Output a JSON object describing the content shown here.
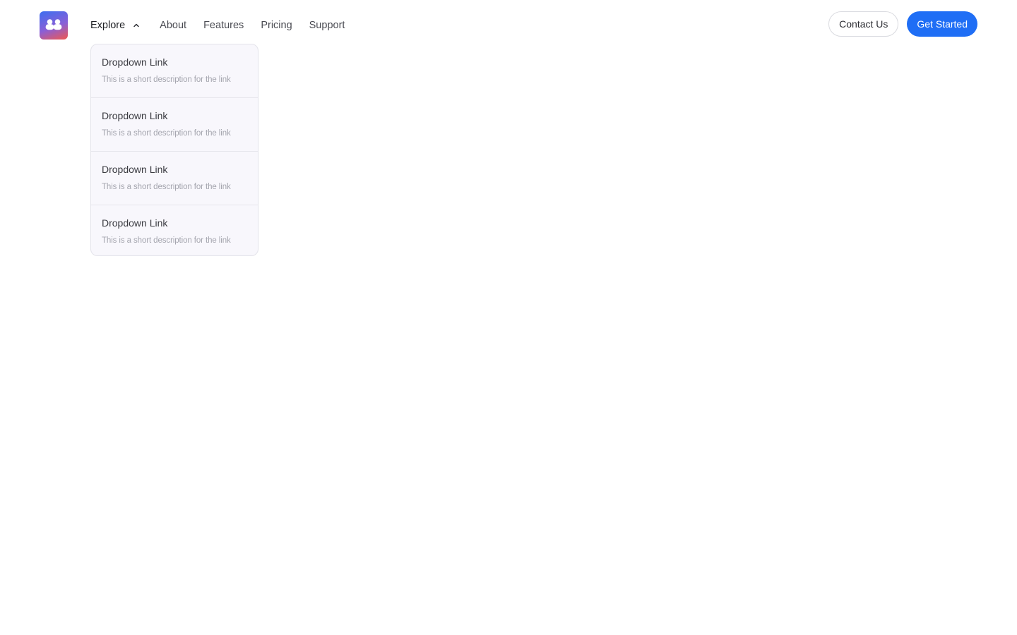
{
  "brand": {
    "logo_icon": "two-people-icon",
    "gradient": [
      "#3d6ff0",
      "#8a5fd6",
      "#f0584f"
    ]
  },
  "nav": {
    "explore": "Explore",
    "about": "About",
    "features": "Features",
    "pricing": "Pricing",
    "support": "Support",
    "explore_icon": "chevron-up-icon"
  },
  "actions": {
    "contact": "Contact Us",
    "get_started": "Get Started",
    "accent_color": "#1f6ef5"
  },
  "dropdown": {
    "items": [
      {
        "title": "Dropdown Link",
        "description": "This is a short description for the link"
      },
      {
        "title": "Dropdown Link",
        "description": "This is a short description for the link"
      },
      {
        "title": "Dropdown Link",
        "description": "This is a short description for the link"
      },
      {
        "title": "Dropdown Link",
        "description": "This is a short description for the link"
      }
    ]
  }
}
